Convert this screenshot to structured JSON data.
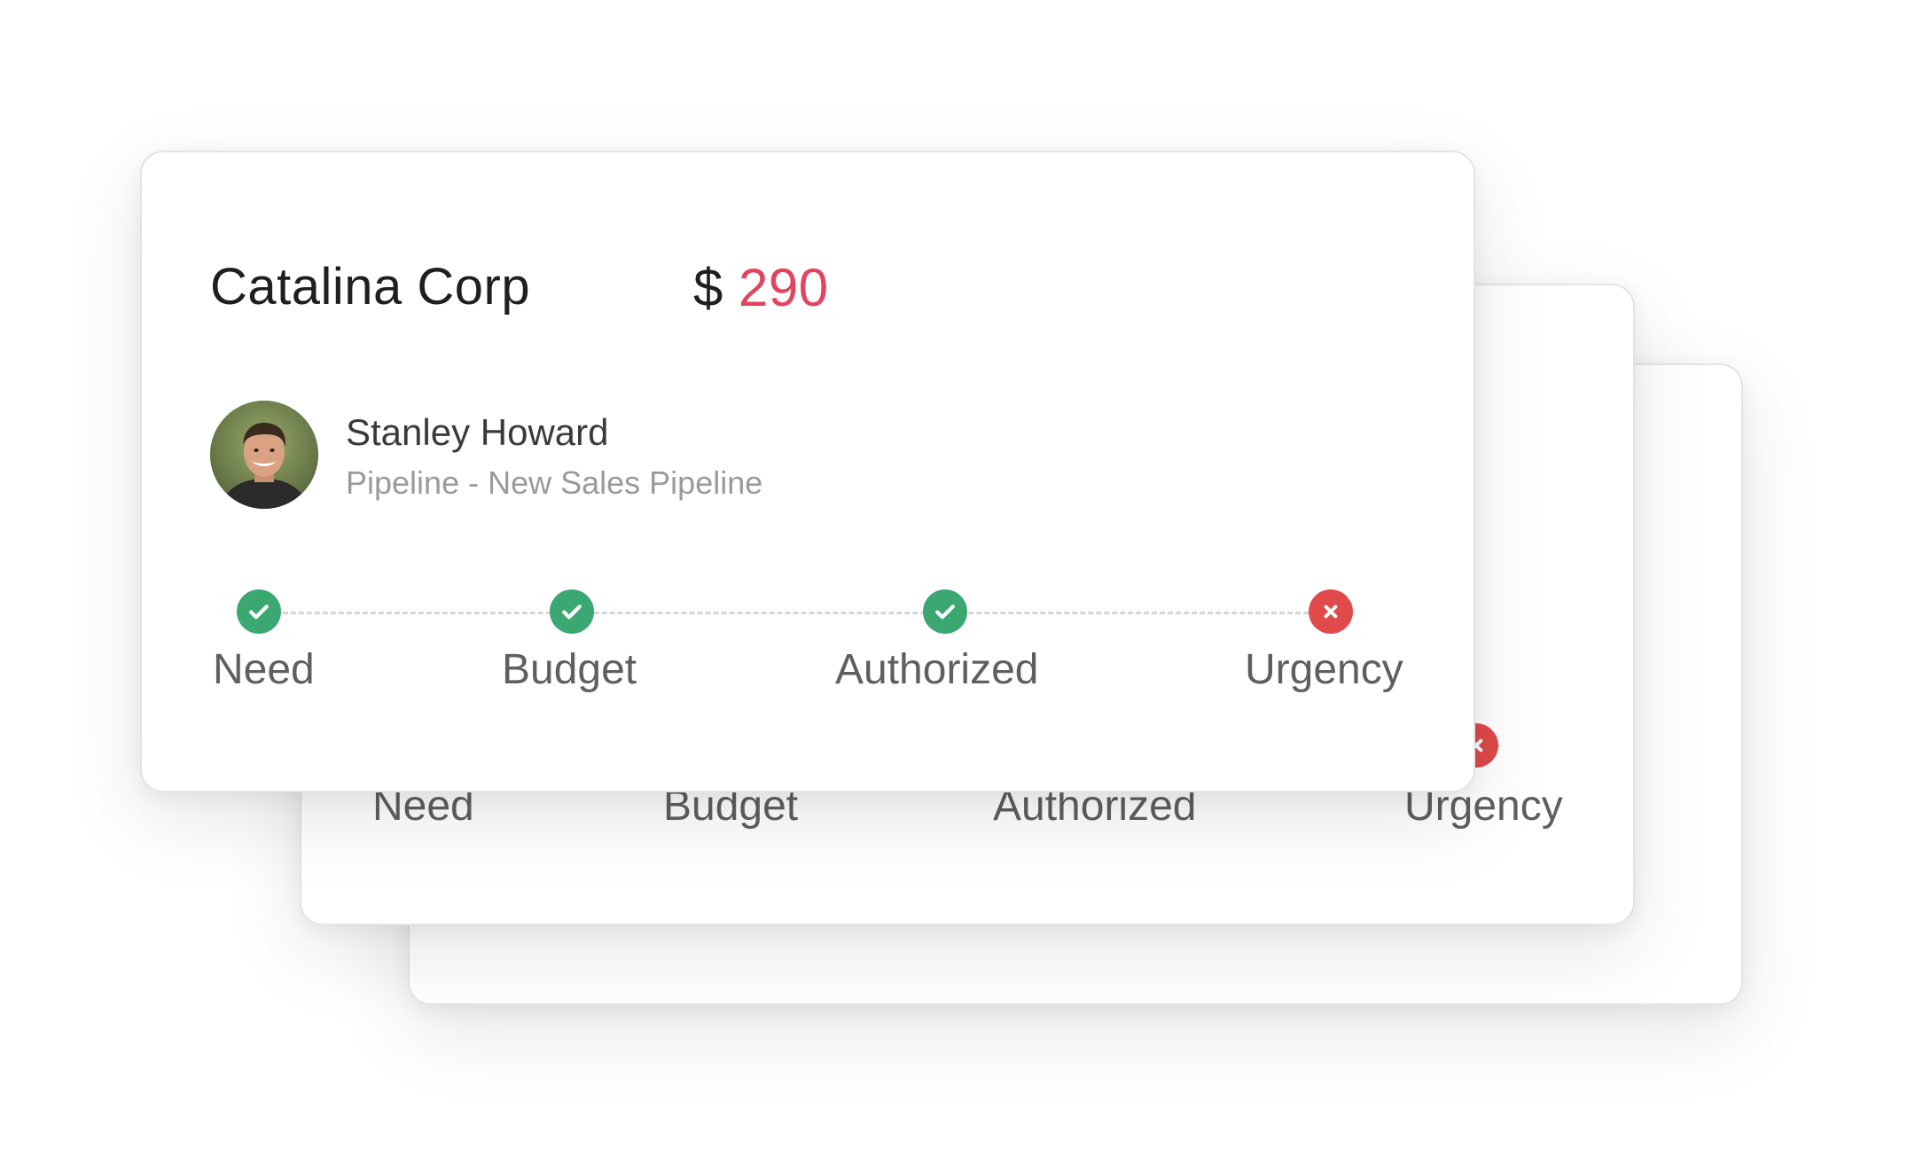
{
  "deal": {
    "company": "Catalina Corp",
    "currency_symbol": "$",
    "amount": "290",
    "contact_name": "Stanley Howard",
    "pipeline_label": "Pipeline - New Sales Pipeline"
  },
  "stages": [
    {
      "label": "Need",
      "status": "complete",
      "icon": "check-icon"
    },
    {
      "label": "Budget",
      "status": "complete",
      "icon": "check-icon"
    },
    {
      "label": "Authorized",
      "status": "complete",
      "icon": "check-icon"
    },
    {
      "label": "Urgency",
      "status": "incomplete",
      "icon": "close-icon"
    }
  ],
  "colors": {
    "accent_amount": "#e5425c",
    "complete": "#3aa870",
    "incomplete": "#e14a4a"
  }
}
